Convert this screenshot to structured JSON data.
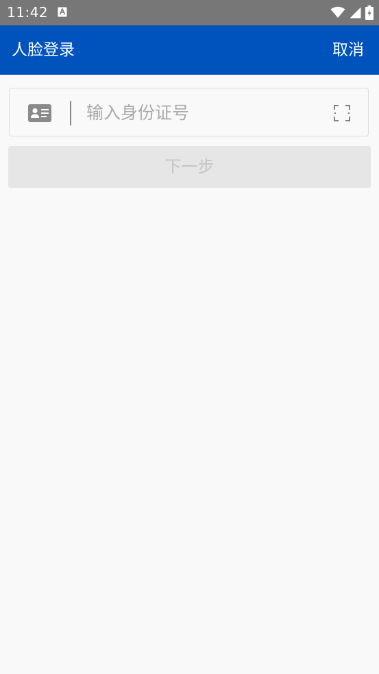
{
  "status_bar": {
    "time": "11:42",
    "icons": [
      "font-notification-icon",
      "wifi-icon",
      "signal-icon",
      "battery-charging-icon"
    ]
  },
  "app_bar": {
    "title": "人脸登录",
    "cancel_label": "取消"
  },
  "form": {
    "id_placeholder": "输入身份证号",
    "id_value": "",
    "next_label": "下一步",
    "next_enabled": false
  },
  "colors": {
    "app_bar": "#0052bd",
    "status_bar": "#777777",
    "background": "#f9f9f9",
    "button_disabled_bg": "#e6e6e6",
    "button_disabled_text": "#c4c4c4"
  }
}
